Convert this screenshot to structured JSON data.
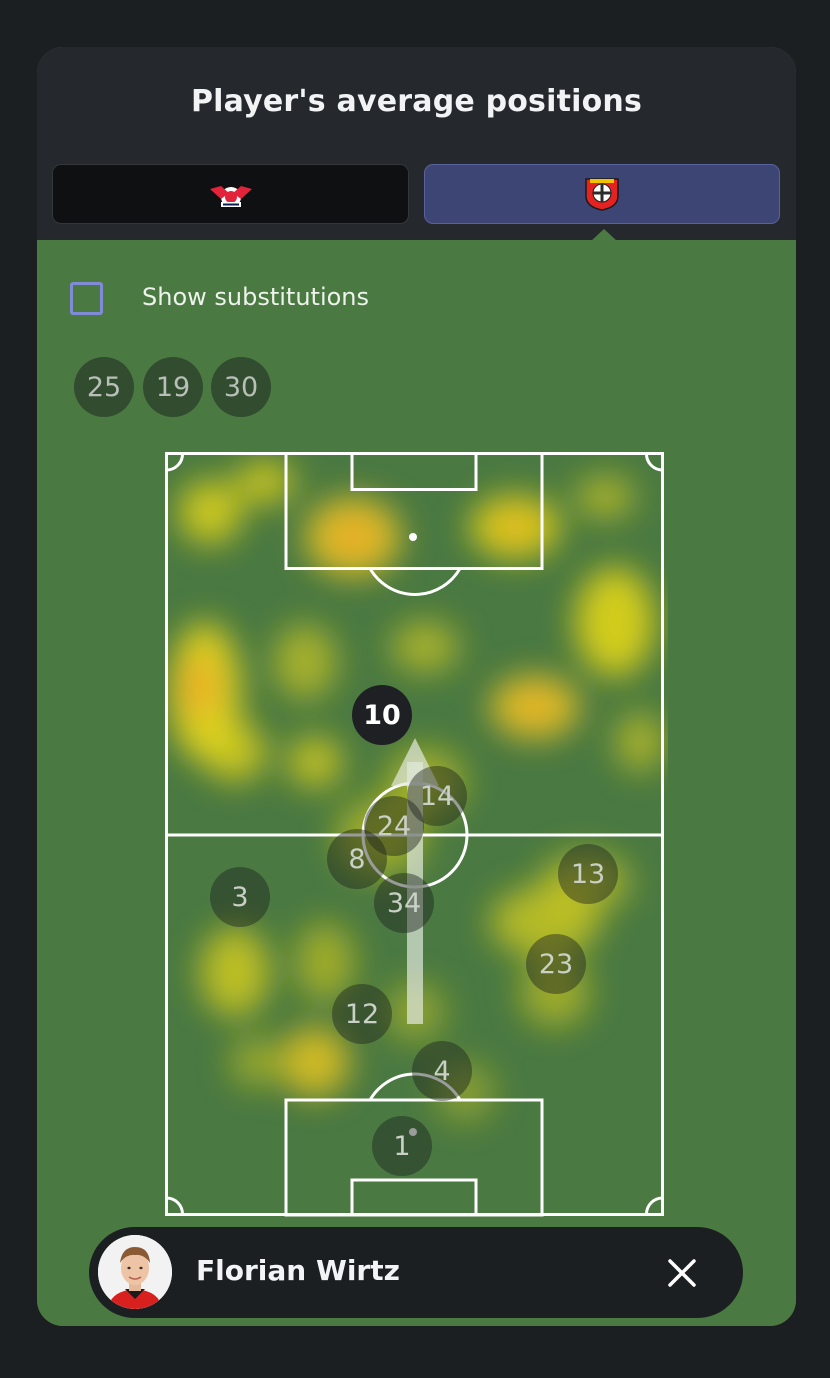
{
  "title": "Player's average positions",
  "tabs": [
    {
      "team": "RB Leipzig",
      "icon": "rb-leipzig-crest-icon",
      "selected": false
    },
    {
      "team": "Bayer 04 Leverkusen",
      "icon": "bayer-leverkusen-crest-icon",
      "selected": true
    }
  ],
  "show_substitutions": {
    "label": "Show substitutions",
    "checked": false
  },
  "substitutes": [
    "25",
    "19",
    "30"
  ],
  "players": [
    "10",
    "14",
    "24",
    "8",
    "13",
    "3",
    "34",
    "23",
    "12",
    "4",
    "1"
  ],
  "selected_player": {
    "number": "10",
    "name": "Florian Wirtz"
  },
  "colors": {
    "accent": "#7f8bd6",
    "pitch": "#4a7942",
    "selected_tab": "#3d4575",
    "heat_low": "#e1d51a",
    "heat_high": "#f2a228"
  }
}
